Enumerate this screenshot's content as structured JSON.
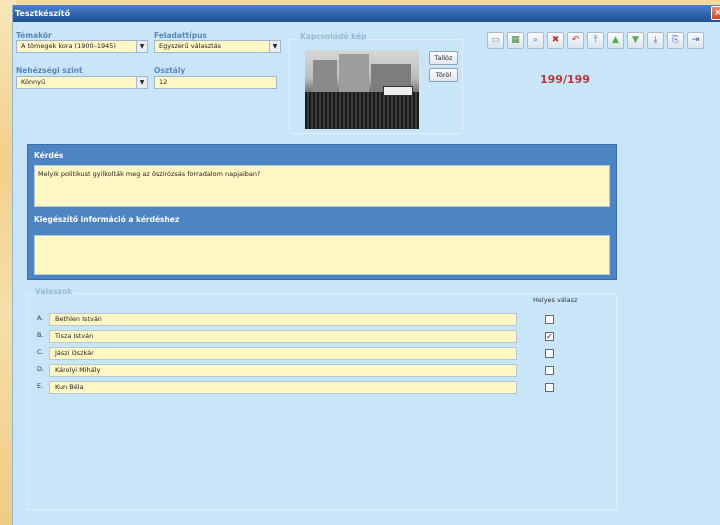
{
  "window": {
    "title": "Tesztkészítő",
    "close_label": "×"
  },
  "fields": {
    "topic_label": "Témakör",
    "topic_value": "A tömegek kora (1900–1945)",
    "task_type_label": "Feladattípus",
    "task_type_value": "Egyszerű választás",
    "difficulty_label": "Nehézségi szint",
    "difficulty_value": "Könnyű",
    "grade_label": "Osztály",
    "grade_value": "12"
  },
  "image_group": {
    "legend": "Kapcsolódó kép",
    "browse_label": "Tallóz",
    "delete_label": "Töröl"
  },
  "counter": "199/199",
  "toolbar": {
    "icons": [
      "new-icon",
      "save-icon",
      "search-icon",
      "delete-icon",
      "undo-icon",
      "first-icon",
      "up-icon",
      "down-icon",
      "last-icon",
      "export-icon",
      "exit-icon"
    ],
    "glyphs": [
      "▭",
      "▦",
      "⌕",
      "✖",
      "↶",
      "⤒",
      "▲",
      "▼",
      "⤓",
      "⎘",
      "⇥"
    ],
    "colors": [
      "#7d8fa3",
      "#3c8f3a",
      "#3a66b7",
      "#c0392b",
      "#c0392b",
      "#3a66b7",
      "#4caf50",
      "#4caf50",
      "#3a66b7",
      "#3a66b7",
      "#3a66b7"
    ]
  },
  "question": {
    "heading": "Kérdés",
    "text": "Melyik politikust gyilkolták meg az őszirózsás forradalom napjaiban?",
    "extra_heading": "Kiegészítő információ a kérdéshez",
    "extra_text": ""
  },
  "answers": {
    "legend": "Válaszok",
    "correct_header": "Helyes válasz",
    "items": [
      {
        "letter": "A.",
        "text": "Bethlen István",
        "correct": false
      },
      {
        "letter": "B.",
        "text": "Tisza István",
        "correct": true
      },
      {
        "letter": "C.",
        "text": "Jászi Oszkár",
        "correct": false
      },
      {
        "letter": "D.",
        "text": "Károlyi Mihály",
        "correct": false
      },
      {
        "letter": "E.",
        "text": "Kun Béla",
        "correct": false
      }
    ]
  }
}
